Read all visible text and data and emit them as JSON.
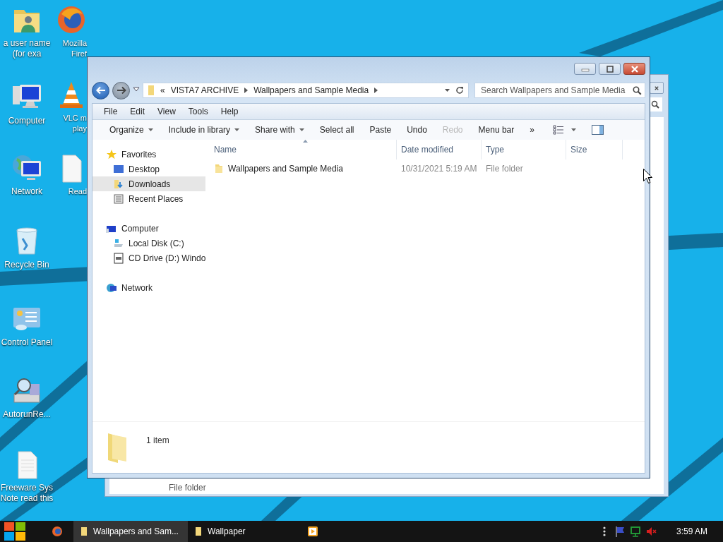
{
  "desktop_icons": [
    {
      "label": "a user name\n(for exa"
    },
    {
      "label": "Computer"
    },
    {
      "label": "Network"
    },
    {
      "label": "Recycle Bin"
    },
    {
      "label": "Control Panel"
    },
    {
      "label": "AutorunRe..."
    },
    {
      "label": "Freeware Sys\nNote read this"
    },
    {
      "label": "Mozilla\nFiref"
    },
    {
      "label": "VLC m\nplay"
    },
    {
      "label": "Read"
    }
  ],
  "back_window": {
    "row_type": "File folder"
  },
  "window": {
    "address": {
      "overflow": "«",
      "segments": [
        "VISTA7 ARCHIVE",
        "Wallpapers and Sample Media"
      ]
    },
    "search": {
      "placeholder": "Search Wallpapers and Sample Media"
    },
    "menu": [
      "File",
      "Edit",
      "View",
      "Tools",
      "Help"
    ],
    "toolbar": [
      {
        "label": "Organize",
        "dropdown": true,
        "disabled": false
      },
      {
        "label": "Include in library",
        "dropdown": true,
        "disabled": false
      },
      {
        "label": "Share with",
        "dropdown": true,
        "disabled": false
      },
      {
        "label": "Select all",
        "dropdown": false,
        "disabled": false
      },
      {
        "label": "Paste",
        "dropdown": false,
        "disabled": false
      },
      {
        "label": "Undo",
        "dropdown": false,
        "disabled": false
      },
      {
        "label": "Redo",
        "dropdown": false,
        "disabled": true
      },
      {
        "label": "Menu bar",
        "dropdown": false,
        "disabled": false
      },
      {
        "label": "»",
        "dropdown": false,
        "disabled": false
      }
    ],
    "nav": [
      {
        "label": "Favorites",
        "children": [
          {
            "label": "Desktop",
            "selected": false
          },
          {
            "label": "Downloads",
            "selected": true
          },
          {
            "label": "Recent Places",
            "selected": false
          }
        ]
      },
      {
        "label": "Computer",
        "children": [
          {
            "label": "Local Disk (C:)",
            "selected": false
          },
          {
            "label": "CD Drive (D:) Windo",
            "selected": false
          }
        ]
      },
      {
        "label": "Network"
      }
    ],
    "columns": [
      {
        "label": "Name",
        "sorted": true
      },
      {
        "label": "Date modified",
        "sorted": false
      },
      {
        "label": "Type",
        "sorted": false
      },
      {
        "label": "Size",
        "sorted": false
      }
    ],
    "rows": [
      {
        "name": "Wallpapers and Sample Media",
        "date": "10/31/2021 5:19 AM",
        "type": "File folder"
      }
    ],
    "status": "1 item"
  },
  "taskbar": {
    "tasks": [
      {
        "label": "Wallpapers and Sam...",
        "selected": true
      },
      {
        "label": "Wallpaper",
        "selected": false
      }
    ],
    "clock": "3:59 AM"
  }
}
